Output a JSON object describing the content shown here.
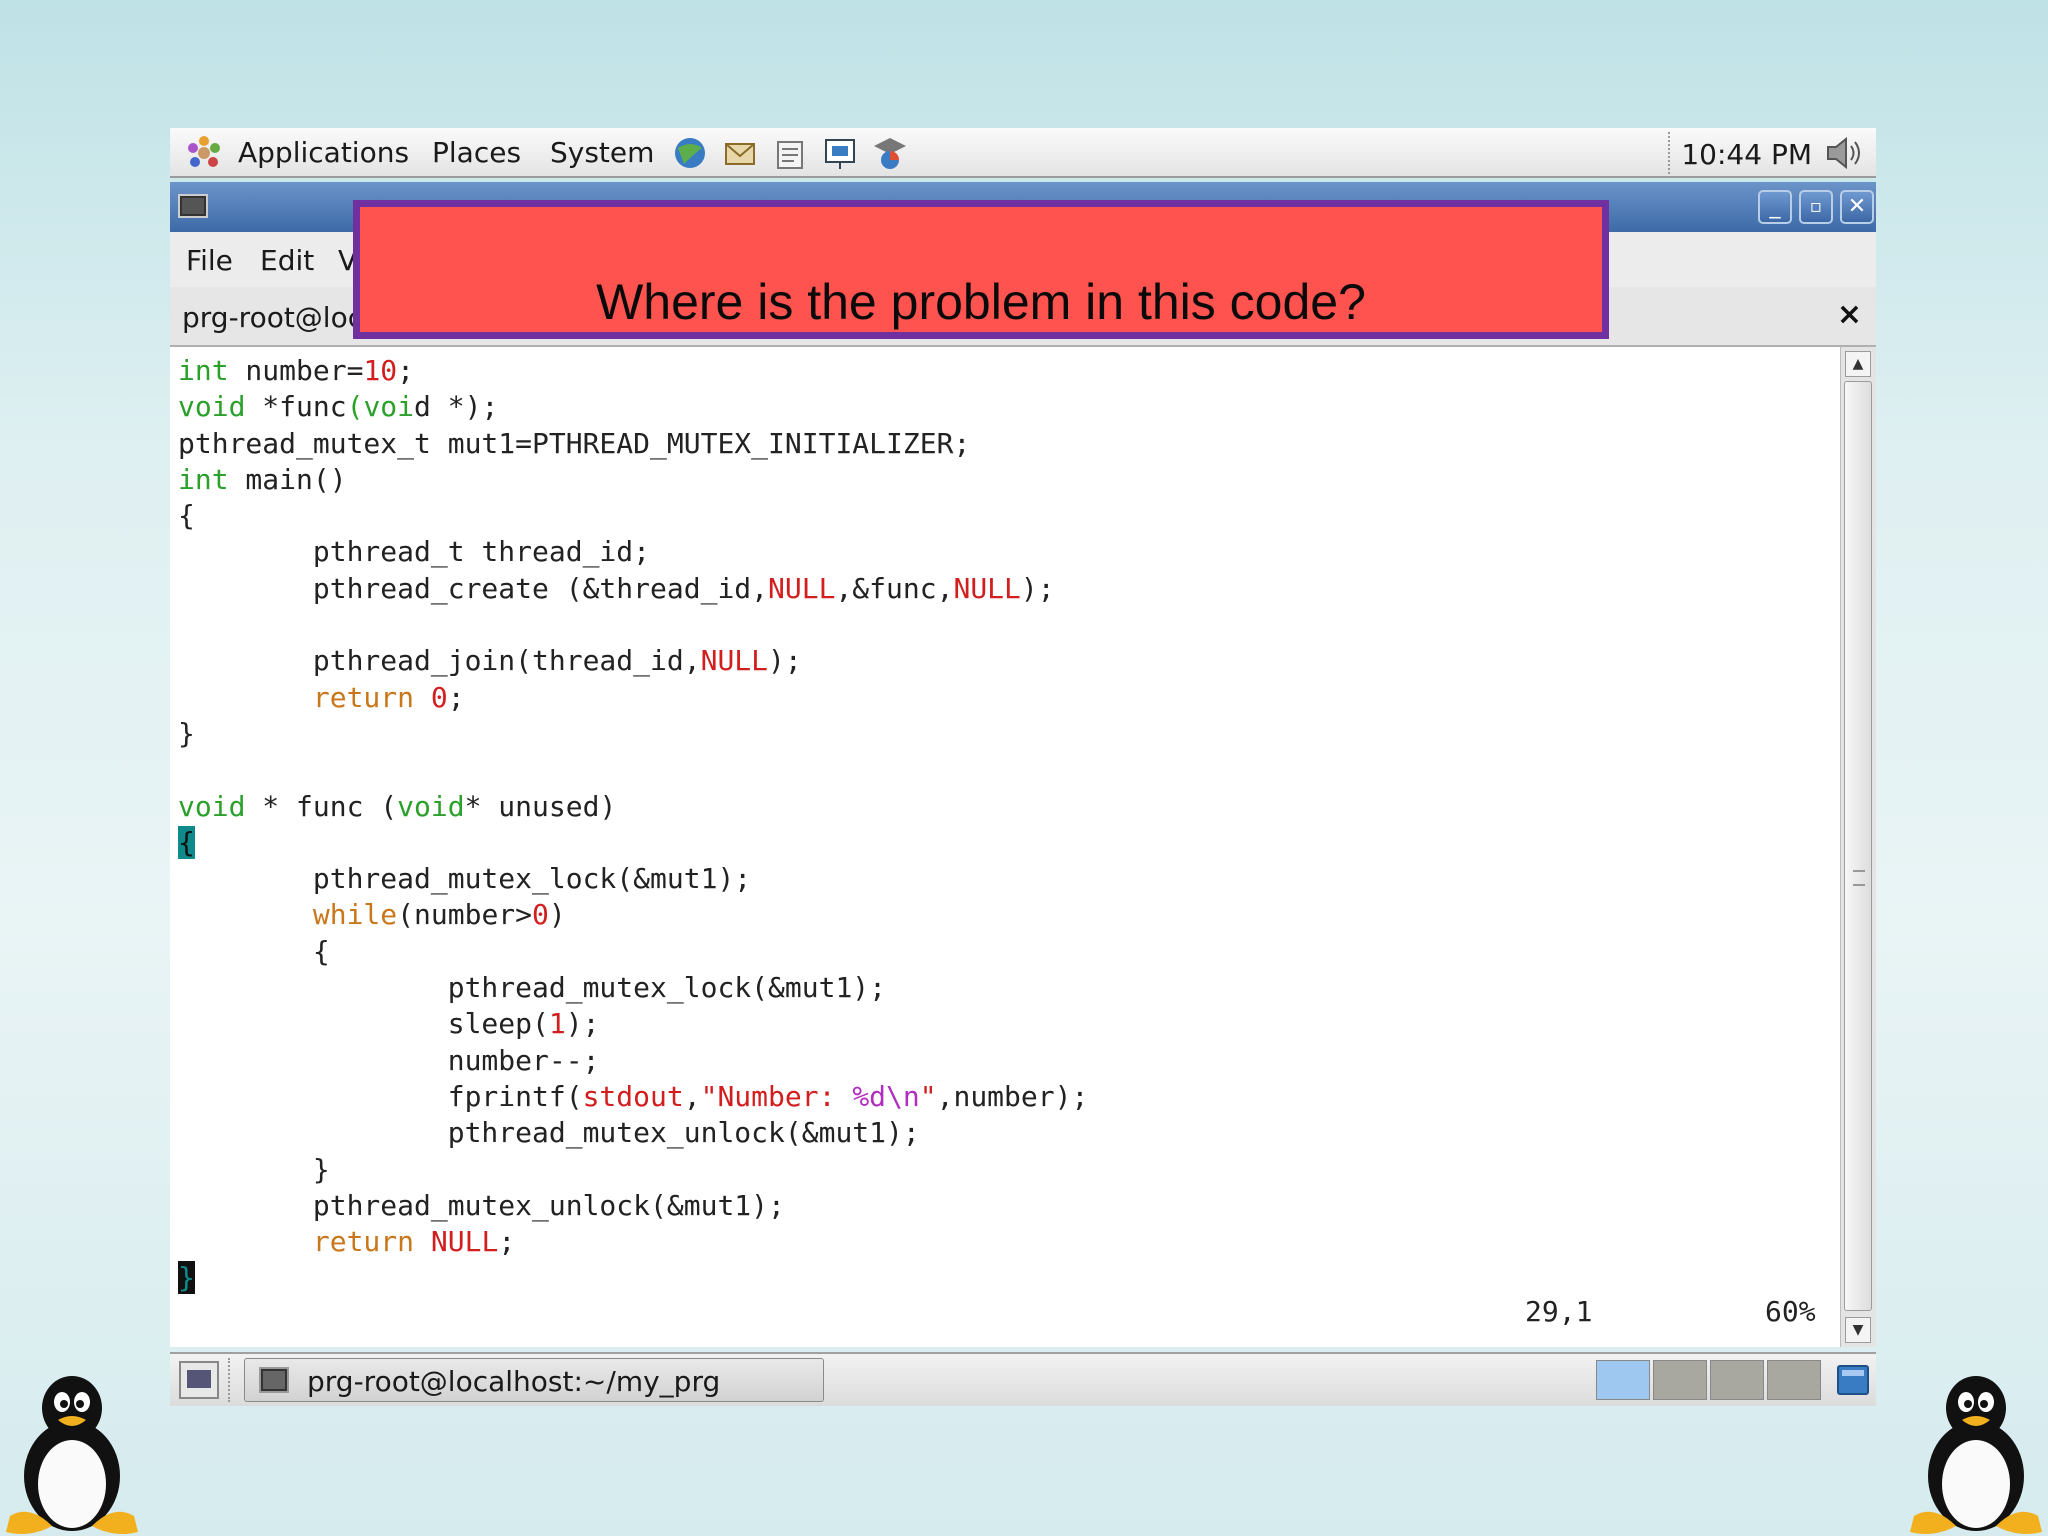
{
  "top_panel": {
    "menus": [
      "Applications",
      "Places",
      "System"
    ],
    "launchers": [
      "web-browser-icon",
      "mail-icon",
      "text-editor-icon",
      "presentation-icon",
      "screenshot-icon"
    ],
    "clock": "10:44 PM",
    "volume_icon": "speaker-icon"
  },
  "window": {
    "menus": {
      "file": "File",
      "edit": "Edit",
      "view": "V"
    },
    "tab_label": "prg-root@loc",
    "tab_close": "×",
    "controls": {
      "minimize": "_",
      "maximize": "▫",
      "close": "✕"
    }
  },
  "callout": {
    "text": "Where is the problem in this code?",
    "background": "#ff5350",
    "border": "#7030a0"
  },
  "editor": {
    "code_lines": [
      "int number=10;",
      "void *func(void *);",
      "pthread_mutex_t mut1=PTHREAD_MUTEX_INITIALIZER;",
      "int main()",
      "{",
      "        pthread_t thread_id;",
      "        pthread_create (&thread_id,NULL,&func,NULL);",
      "",
      "        pthread_join(thread_id,NULL);",
      "        return 0;",
      "}",
      "",
      "void * func (void* unused)",
      "{",
      "        pthread_mutex_lock(&mut1);",
      "        while(number>0)",
      "        {",
      "                pthread_mutex_lock(&mut1);",
      "                sleep(1);",
      "                number--;",
      "                fprintf(stdout,\"Number: %d\\n\",number);",
      "                pthread_mutex_unlock(&mut1);",
      "        }",
      "        pthread_mutex_unlock(&mut1);",
      "        return NULL;",
      "}"
    ],
    "status_position": "29,1",
    "status_percent": "60%"
  },
  "bottom_panel": {
    "task_label": "prg-root@localhost:~/my_prg",
    "workspaces": 4,
    "active_workspace": 1
  }
}
